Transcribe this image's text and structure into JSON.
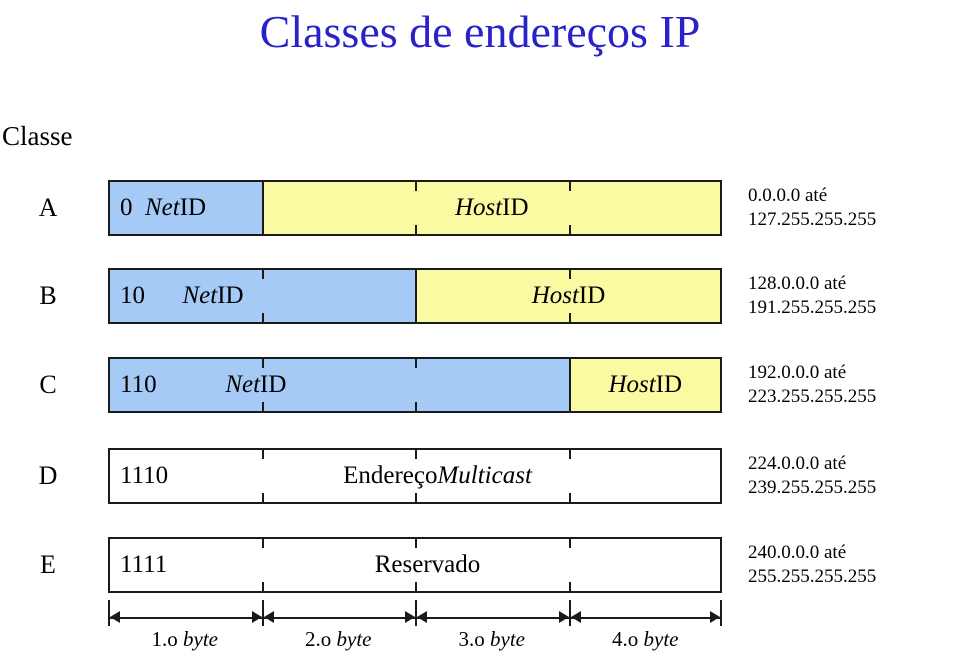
{
  "title": "Classes de endereços IP",
  "classe_heading": "Classe",
  "rows": [
    {
      "letter": "A",
      "prefix": "0",
      "net_label": "Net",
      "net_label_suffix": " ID",
      "host_label": "Host",
      "host_label_suffix": " ID",
      "range_from": "0.0.0.0 até",
      "range_to": "127.255.255.255"
    },
    {
      "letter": "B",
      "prefix": "10",
      "net_label": "Net",
      "net_label_suffix": " ID",
      "host_label": "Host",
      "host_label_suffix": " ID",
      "range_from": "128.0.0.0 até",
      "range_to": "191.255.255.255"
    },
    {
      "letter": "C",
      "prefix": "110",
      "net_label": "Net",
      "net_label_suffix": " ID",
      "host_label": "Host",
      "host_label_suffix": " ID",
      "range_from": "192.0.0.0 até",
      "range_to": "223.255.255.255"
    },
    {
      "letter": "D",
      "prefix": "1110",
      "body_label": "Endereço ",
      "body_label_italic": "Multicast",
      "range_from": "224.0.0.0 até",
      "range_to": "239.255.255.255"
    },
    {
      "letter": "E",
      "prefix": "1111",
      "body_label": "Reservado",
      "body_label_italic": "",
      "range_from": "240.0.0.0 até",
      "range_to": "255.255.255.255"
    }
  ],
  "ruler": {
    "bytes": [
      {
        "num": "1.o ",
        "unit": "byte"
      },
      {
        "num": "2.o ",
        "unit": "byte"
      },
      {
        "num": "3.o ",
        "unit": "byte"
      },
      {
        "num": "4.o ",
        "unit": "byte"
      }
    ]
  },
  "colors": {
    "title": "#2822c8",
    "net_id_fill": "#a5caf5",
    "host_id_fill": "#fafaa2",
    "reserved_fill": "#ffffff",
    "outline": "#1a1a1a"
  }
}
